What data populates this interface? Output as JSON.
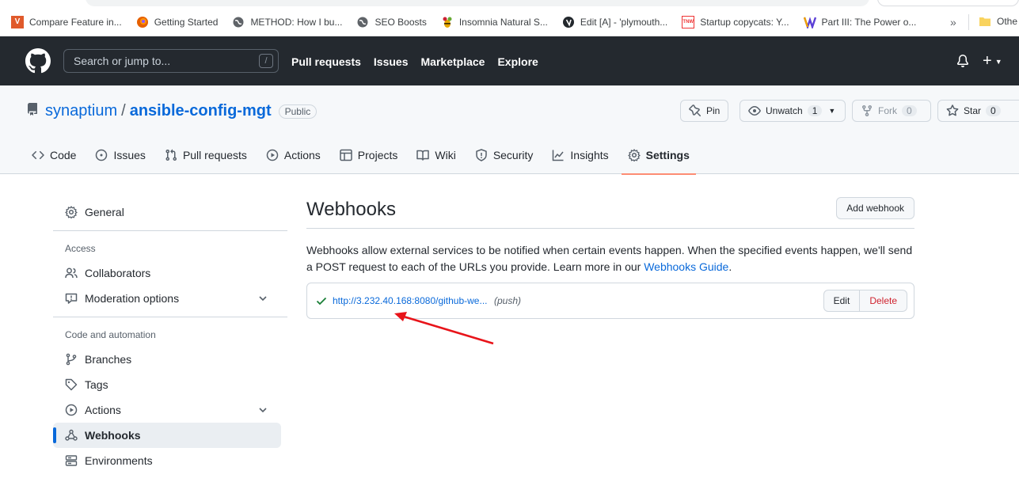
{
  "bookmarks": [
    {
      "label": "Compare Feature in...",
      "icon": "vivaldi-icon",
      "color": "#e05a2b",
      "glyph": "V"
    },
    {
      "label": "Getting Started",
      "icon": "firefox-icon",
      "color": "#e66000",
      "glyph": ""
    },
    {
      "label": "METHOD: How I bu...",
      "icon": "globe-icon",
      "color": "#5f6368",
      "glyph": ""
    },
    {
      "label": "SEO Boosts",
      "icon": "globe-icon",
      "color": "#5f6368",
      "glyph": ""
    },
    {
      "label": "Insomnia Natural S...",
      "icon": "bee-icon",
      "color": "#e6a700",
      "glyph": ""
    },
    {
      "label": "Edit [A] - 'plymouth...",
      "icon": "wordpress-icon",
      "color": "#23282d",
      "glyph": ""
    },
    {
      "label": "Startup copycats: Y...",
      "icon": "tnw-icon",
      "color": "#e33",
      "glyph": "TNW"
    },
    {
      "label": "Part III: The Power o...",
      "icon": "medium-icon",
      "color": "#5b3fd6",
      "glyph": "M"
    }
  ],
  "bookmarks_more": "»",
  "bookmarks_other": "Othe",
  "header": {
    "search_placeholder": "Search or jump to...",
    "search_shortcut": "/",
    "nav": [
      "Pull requests",
      "Issues",
      "Marketplace",
      "Explore"
    ],
    "plus": "+"
  },
  "repo": {
    "owner": "synaptium",
    "separator": "/",
    "name": "ansible-config-mgt",
    "visibility": "Public",
    "pin_label": "Pin",
    "unwatch_label": "Unwatch",
    "unwatch_count": "1",
    "fork_label": "Fork",
    "fork_count": "0",
    "star_label": "Star",
    "star_count": "0"
  },
  "tabs": [
    {
      "label": "Code",
      "icon": "code-icon"
    },
    {
      "label": "Issues",
      "icon": "issue-icon"
    },
    {
      "label": "Pull requests",
      "icon": "pull-request-icon"
    },
    {
      "label": "Actions",
      "icon": "play-icon"
    },
    {
      "label": "Projects",
      "icon": "table-icon"
    },
    {
      "label": "Wiki",
      "icon": "book-icon"
    },
    {
      "label": "Security",
      "icon": "shield-icon"
    },
    {
      "label": "Insights",
      "icon": "graph-icon"
    },
    {
      "label": "Settings",
      "icon": "gear-icon",
      "selected": true
    }
  ],
  "sidebar": {
    "general": "General",
    "access_heading": "Access",
    "collaborators": "Collaborators",
    "moderation": "Moderation options",
    "code_heading": "Code and automation",
    "branches": "Branches",
    "tags": "Tags",
    "actions": "Actions",
    "webhooks": "Webhooks",
    "environments": "Environments"
  },
  "main": {
    "title": "Webhooks",
    "add_button": "Add webhook",
    "description": "Webhooks allow external services to be notified when certain events happen. When the specified events happen, we'll send a POST request to each of the URLs you provide. Learn more in our ",
    "guide_link": "Webhooks Guide",
    "description_end": ".",
    "hook": {
      "url": "http://3.232.40.168:8080/github-we...",
      "events": "(push)",
      "status": "success",
      "edit": "Edit",
      "delete": "Delete"
    }
  },
  "colors": {
    "accent": "#0969da",
    "header_bg": "#24292f",
    "selected_tab_underline": "#fd8c73",
    "danger": "#cf222e",
    "success": "#1a7f37",
    "annotation_arrow": "#e8141a"
  }
}
